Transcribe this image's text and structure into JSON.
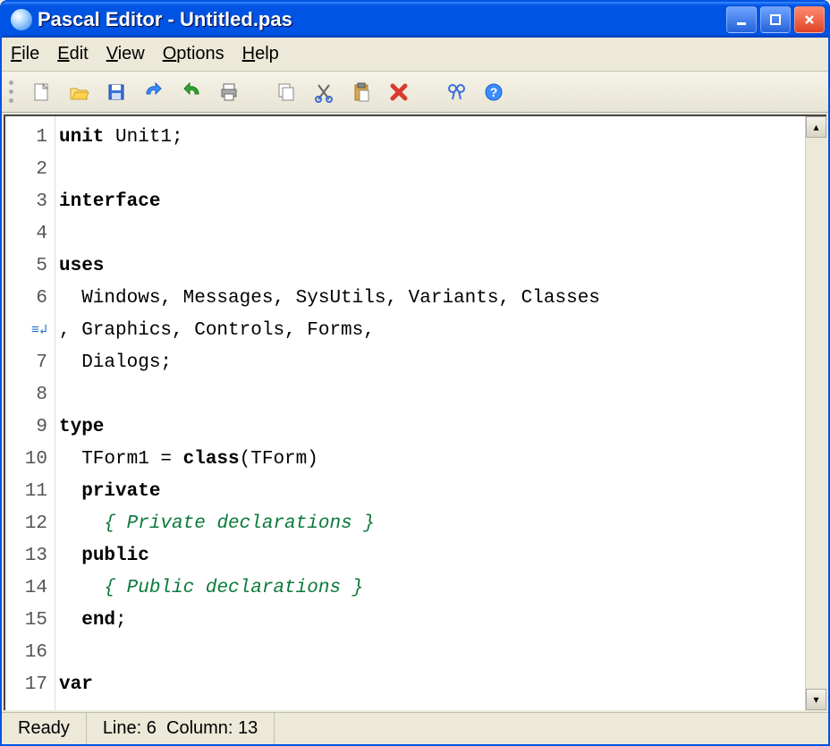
{
  "title": "Pascal Editor - Untitled.pas",
  "menu": {
    "file": "File",
    "edit": "Edit",
    "view": "View",
    "options": "Options",
    "help": "Help"
  },
  "toolbar_icons": [
    "new",
    "open",
    "save",
    "undo",
    "redo",
    "print",
    "copy",
    "cut",
    "paste",
    "delete",
    "find",
    "help"
  ],
  "code": {
    "gutter": [
      "1",
      "2",
      "3",
      "4",
      "5",
      "6",
      "",
      "7",
      "8",
      "9",
      "10",
      "11",
      "12",
      "13",
      "14",
      "15",
      "16",
      "17"
    ],
    "wrap_line_index": 6,
    "lines": [
      [
        {
          "t": "unit",
          "c": "kw"
        },
        {
          "t": " Unit1;",
          "c": ""
        }
      ],
      [],
      [
        {
          "t": "interface",
          "c": "kw"
        }
      ],
      [],
      [
        {
          "t": "uses",
          "c": "kw"
        }
      ],
      [
        {
          "t": "  Windows, Messages, SysUtils, Variants, Classes",
          "c": ""
        }
      ],
      [
        {
          "t": ", Graphics, Controls, Forms,",
          "c": ""
        }
      ],
      [
        {
          "t": "  Dialogs;",
          "c": ""
        }
      ],
      [],
      [
        {
          "t": "type",
          "c": "kw"
        }
      ],
      [
        {
          "t": "  TForm1 = ",
          "c": ""
        },
        {
          "t": "class",
          "c": "kw"
        },
        {
          "t": "(TForm)",
          "c": ""
        }
      ],
      [
        {
          "t": "  ",
          "c": ""
        },
        {
          "t": "private",
          "c": "kw"
        }
      ],
      [
        {
          "t": "    ",
          "c": ""
        },
        {
          "t": "{ Private declarations }",
          "c": "cm"
        }
      ],
      [
        {
          "t": "  ",
          "c": ""
        },
        {
          "t": "public",
          "c": "kw"
        }
      ],
      [
        {
          "t": "    ",
          "c": ""
        },
        {
          "t": "{ Public declarations }",
          "c": "cm"
        }
      ],
      [
        {
          "t": "  ",
          "c": ""
        },
        {
          "t": "end",
          "c": "kw"
        },
        {
          "t": ";",
          "c": ""
        }
      ],
      [],
      [
        {
          "t": "var",
          "c": "kw"
        }
      ]
    ]
  },
  "status": {
    "ready": "Ready",
    "line_label": "Line:",
    "line_val": "6",
    "col_label": "Column:",
    "col_val": "13"
  }
}
